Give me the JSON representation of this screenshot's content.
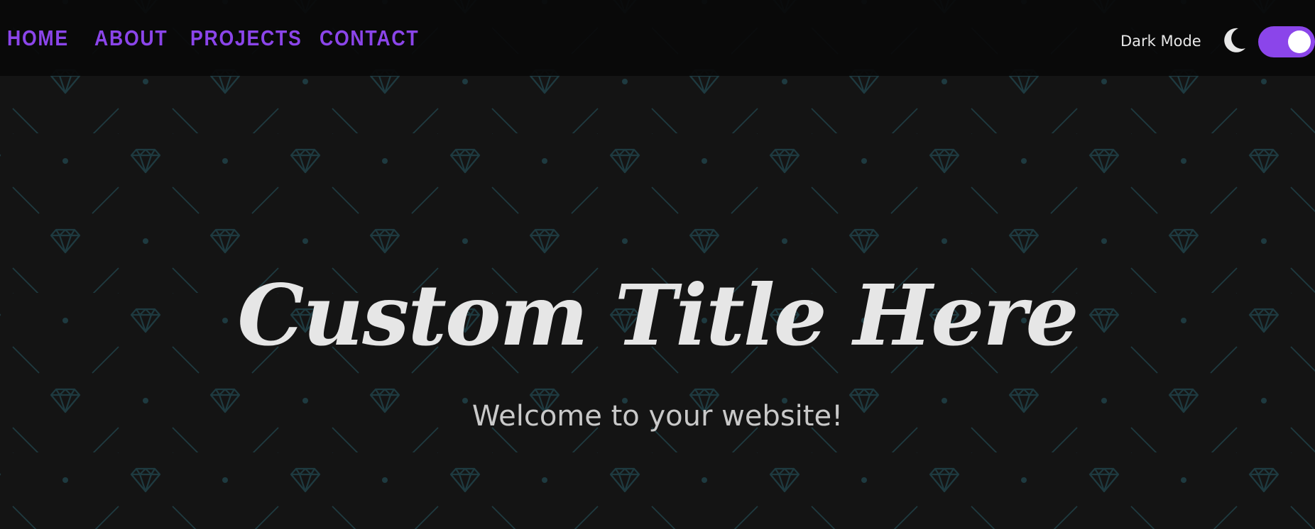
{
  "nav": {
    "links": [
      "HOME",
      "ABOUT",
      "PROJECTS",
      "CONTACT"
    ],
    "dark_mode_label": "Dark Mode",
    "dark_mode_on": true,
    "moon_icon": "moon-icon"
  },
  "hero": {
    "title": "Custom Title Here",
    "subtitle": "Welcome to your website!"
  },
  "colors": {
    "accent": "#8b45ea",
    "background": "#141414",
    "nav_background": "#0a0a0a",
    "pattern": "#1e3a40",
    "title": "#e6e6e6",
    "subtitle": "#c9c9c9"
  }
}
